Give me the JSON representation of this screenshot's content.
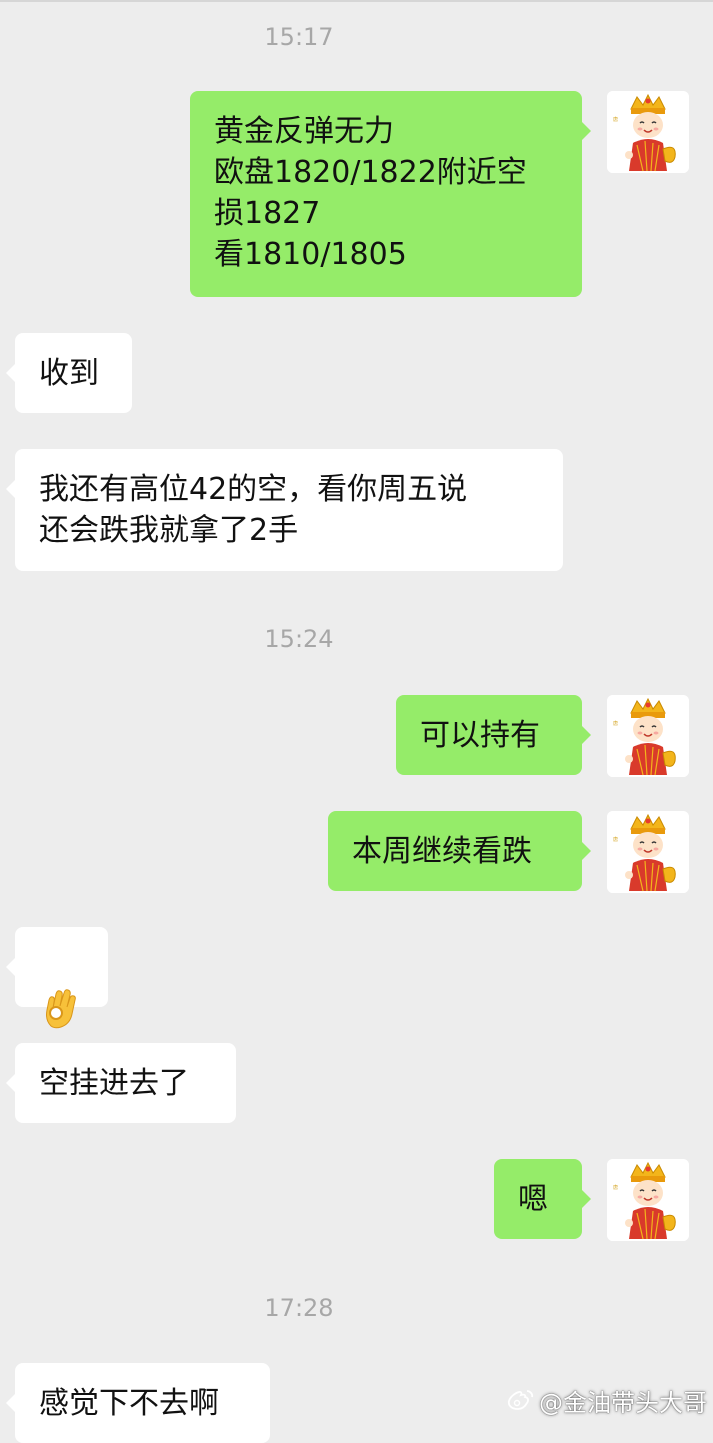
{
  "chat": {
    "messages": [
      {
        "type": "time",
        "text": "15:17"
      },
      {
        "type": "out",
        "text": "黄金反弹无力\n欧盘1820/1822附近空\n损1827\n看1810/1805"
      },
      {
        "type": "in",
        "text": "收到"
      },
      {
        "type": "in",
        "text": "我还有高位42的空，看你周五说\n还会跌我就拿了2手"
      },
      {
        "type": "time",
        "text": "15:24"
      },
      {
        "type": "out",
        "text": "可以持有"
      },
      {
        "type": "out",
        "text": "本周继续看跌"
      },
      {
        "type": "in",
        "icon": "ok-hand-emoji-icon"
      },
      {
        "type": "in",
        "text": "空挂进去了"
      },
      {
        "type": "out",
        "text": "嗯"
      },
      {
        "type": "time",
        "text": "17:28"
      },
      {
        "type": "in",
        "text": "感觉下不去啊"
      }
    ]
  },
  "watermark": {
    "icon": "weibo-icon",
    "text": "@金油带头大哥"
  },
  "colors": {
    "background": "#ededed",
    "outgoing_bubble": "#95ec69",
    "incoming_bubble": "#ffffff",
    "timestamp_text": "#a7a7a7"
  }
}
